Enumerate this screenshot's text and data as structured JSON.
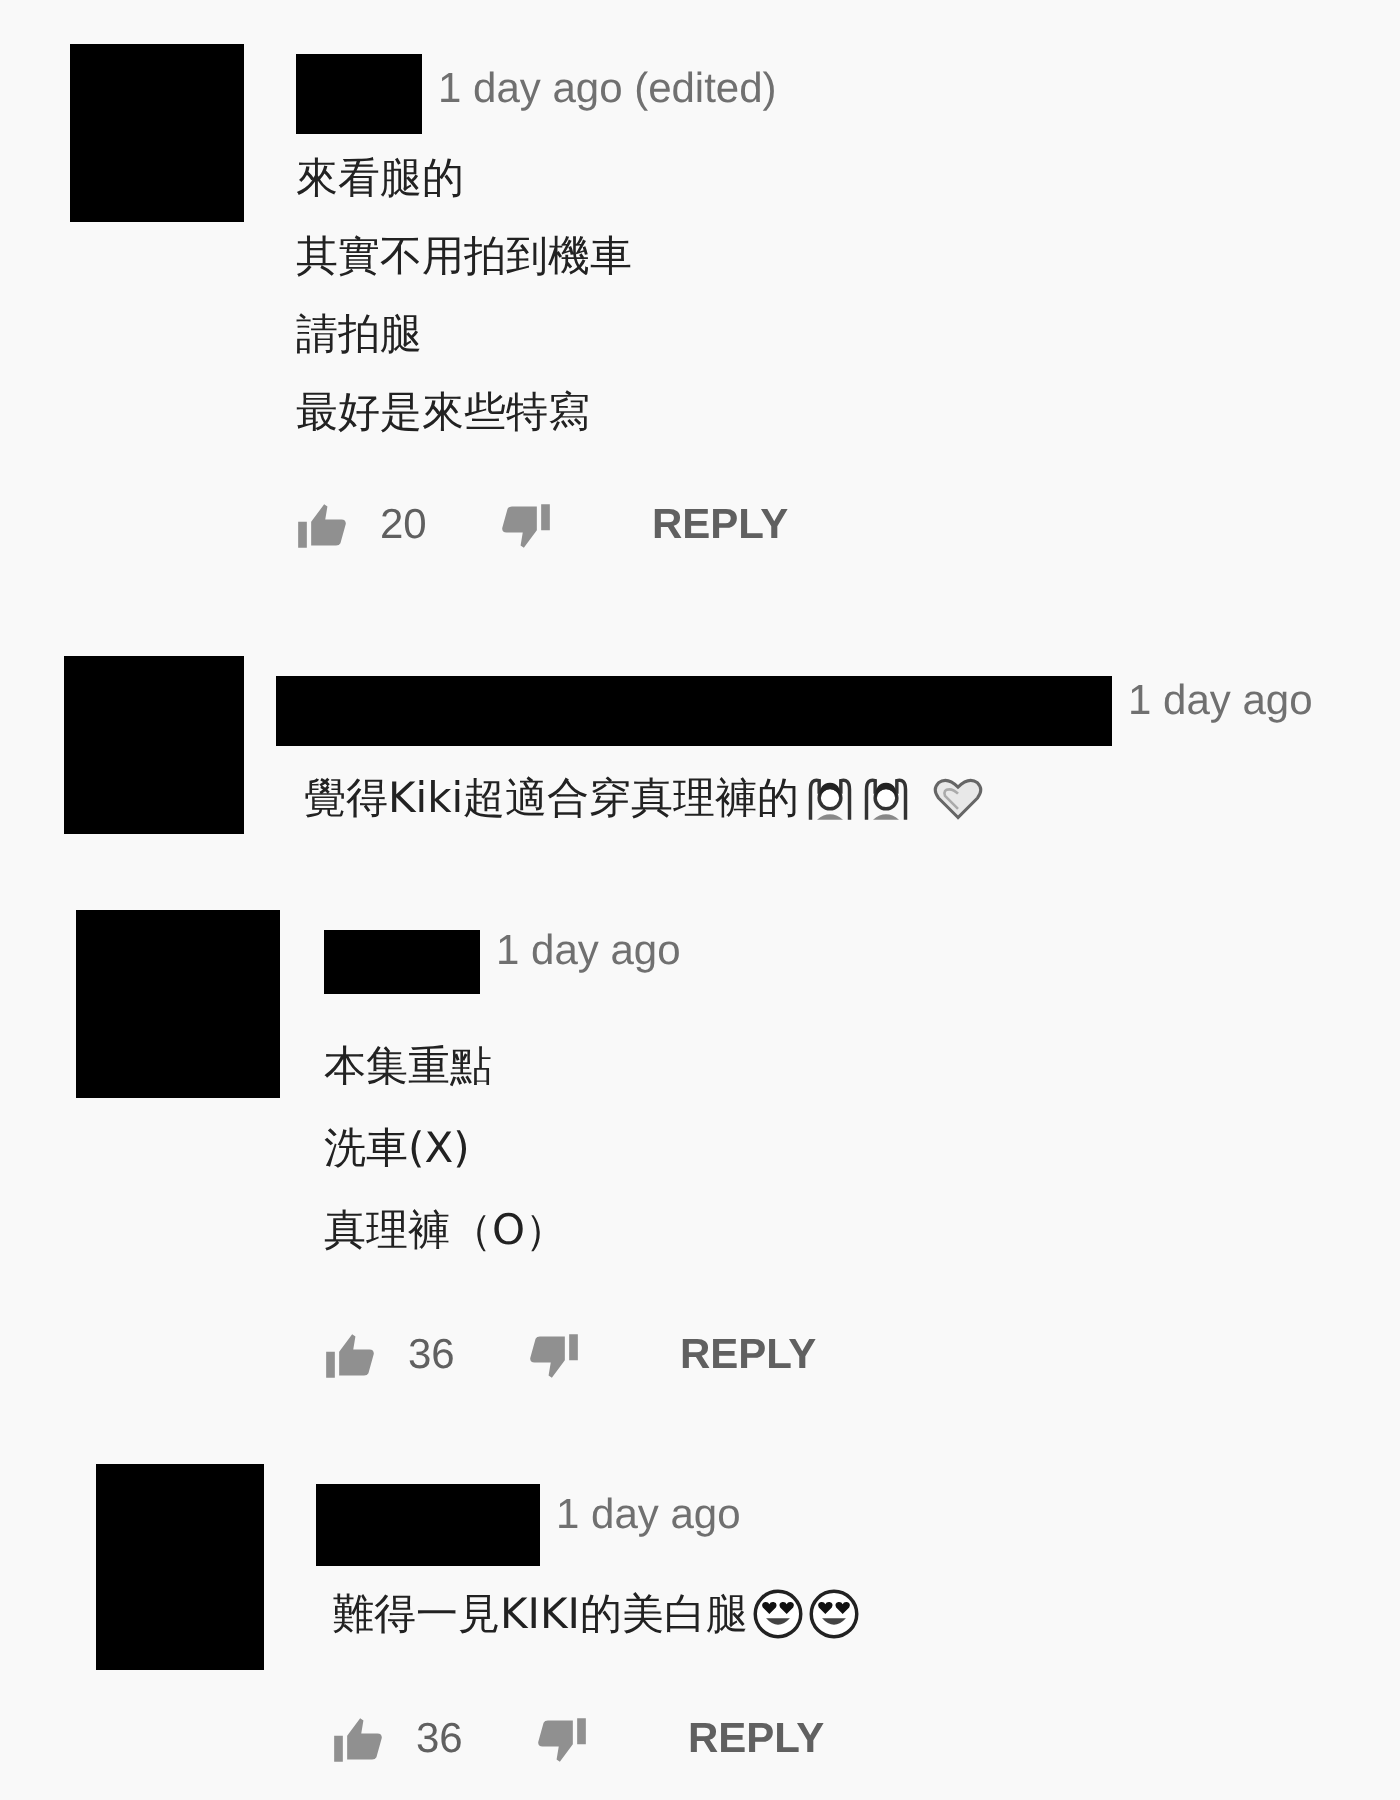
{
  "comments": [
    {
      "time": "1 day ago (edited)",
      "lines": [
        {
          "text": "來看腿的"
        },
        {
          "text": "其實不用拍到機車"
        },
        {
          "text": "請拍腿"
        },
        {
          "text": "最好是來些特寫"
        }
      ],
      "likes": "20",
      "reply": "REPLY"
    },
    {
      "time": "1 day ago",
      "lines": [
        {
          "text": "覺得Kiki超適合穿真理褲的",
          "emojis": [
            {
              "kind": "person"
            },
            {
              "kind": "person"
            },
            {
              "kind": "heart"
            }
          ]
        }
      ]
    },
    {
      "time": "1 day ago",
      "lines": [
        {
          "text": "本集重點"
        },
        {
          "text": "洗車(X)"
        },
        {
          "text": "真理褲（O）"
        }
      ],
      "likes": "36",
      "reply": "REPLY"
    },
    {
      "time": "1 day ago",
      "lines": [
        {
          "text": "難得一見KIKI的美白腿",
          "emojis": [
            {
              "kind": "heart-eyes"
            },
            {
              "kind": "heart-eyes"
            }
          ]
        }
      ],
      "likes": "36",
      "reply": "REPLY"
    }
  ]
}
